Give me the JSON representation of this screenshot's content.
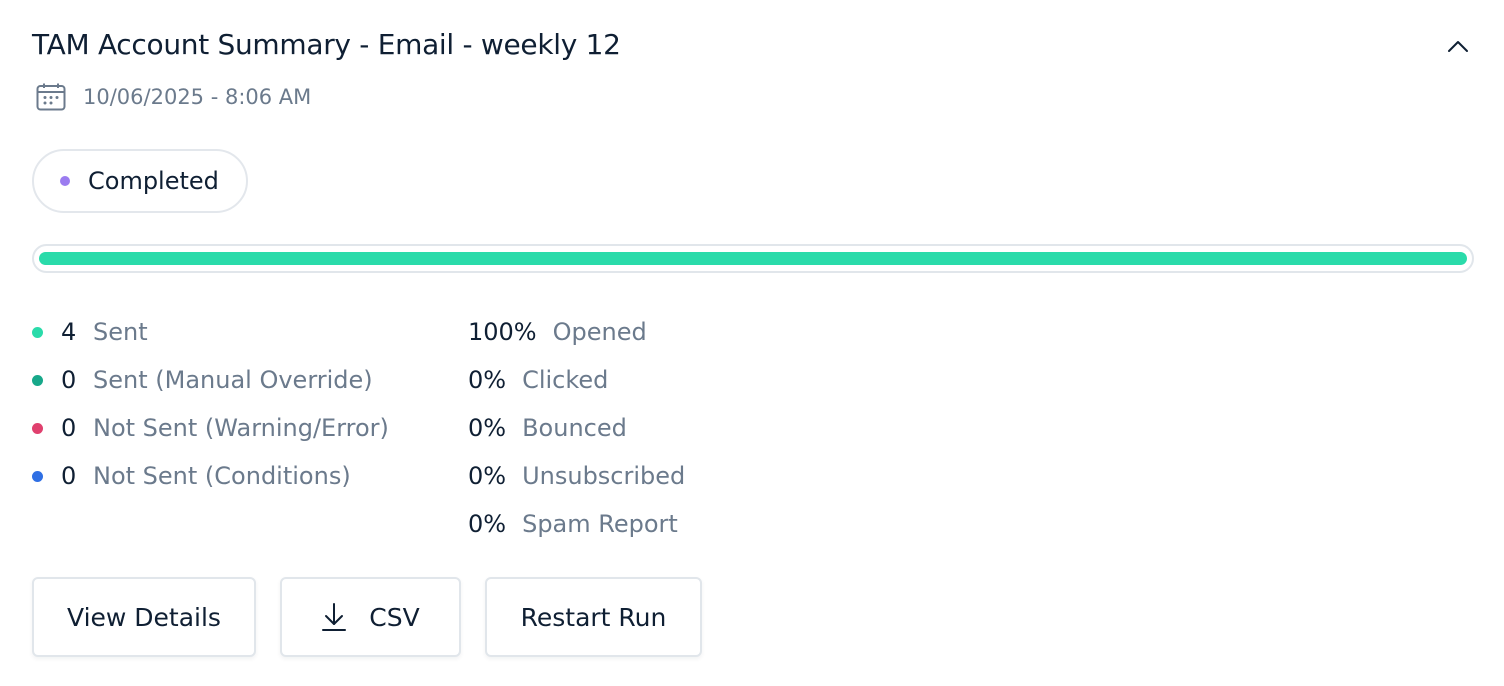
{
  "header": {
    "title": "TAM Account Summary - Email - weekly 12",
    "collapse_icon": "chevron-up-icon",
    "date_icon": "calendar-icon",
    "datetime": "10/06/2025 - 8:06 AM"
  },
  "status": {
    "label": "Completed",
    "dot_color": "#9b7cf0"
  },
  "progress": {
    "fraction": 1.0,
    "color": "#2adbaa"
  },
  "delivery_stats": [
    {
      "count": "4",
      "label": "Sent",
      "color": "#2adbaa"
    },
    {
      "count": "0",
      "label": "Sent (Manual Override)",
      "color": "#17a88a"
    },
    {
      "count": "0",
      "label": "Not Sent (Warning/Error)",
      "color": "#e0406e"
    },
    {
      "count": "0",
      "label": "Not Sent (Conditions)",
      "color": "#2f6fe4"
    }
  ],
  "engagement_stats": [
    {
      "value": "100%",
      "label": "Opened"
    },
    {
      "value": "0%",
      "label": "Clicked"
    },
    {
      "value": "0%",
      "label": "Bounced"
    },
    {
      "value": "0%",
      "label": "Unsubscribed"
    },
    {
      "value": "0%",
      "label": "Spam Report"
    }
  ],
  "actions": {
    "view_details": "View Details",
    "csv": "CSV",
    "csv_icon": "download-icon",
    "restart_run": "Restart Run"
  }
}
